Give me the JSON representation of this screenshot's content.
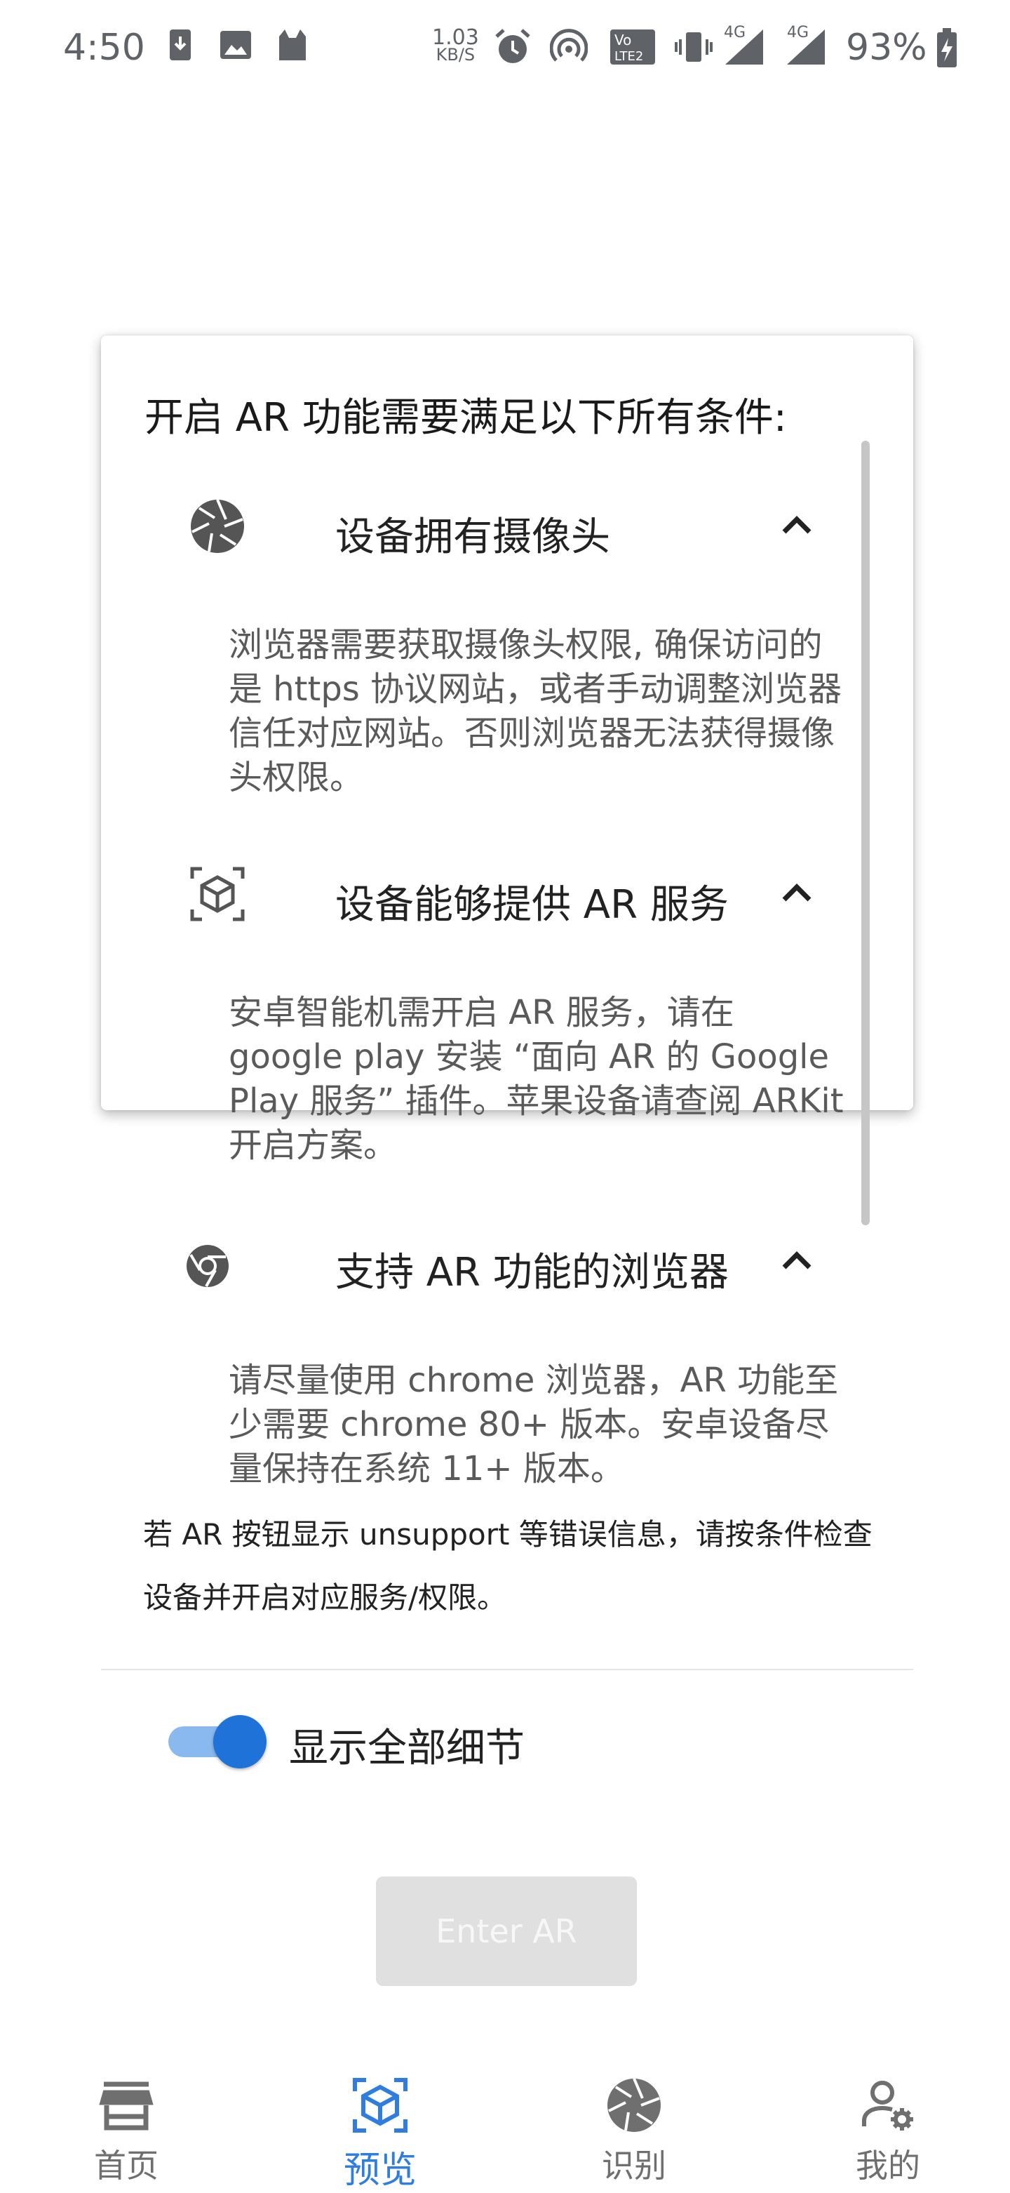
{
  "status_bar": {
    "time": "4:50",
    "speed_value": "1.03",
    "speed_unit": "KB/S",
    "net_label_1": "4G",
    "net_label_2": "4G",
    "battery": "93%",
    "icons": [
      "download-icon",
      "image-icon",
      "cat-app-icon",
      "alarm-icon",
      "hotspot-icon",
      "volte-icon",
      "vibrate-icon",
      "signal-icon",
      "signal-icon",
      "battery-charging-icon"
    ]
  },
  "dialog": {
    "title": "开启 AR 功能需要满足以下所有条件:",
    "requirements": [
      {
        "icon": "camera-aperture-icon",
        "title": "设备拥有摄像头",
        "description": "浏览器需要获取摄像头权限, 确保访问的是 https 协议网站，或者手动调整浏览器信任对应网站。否则浏览器无法获得摄像头权限。"
      },
      {
        "icon": "ar-cube-icon",
        "title": "设备能够提供 AR 服务",
        "description": "安卓智能机需开启 AR 服务，请在 google play 安装 “面向 AR 的 Google Play 服务” 插件。苹果设备请查阅 ARKit 开启方案。"
      },
      {
        "icon": "chrome-icon",
        "title": "支持 AR 功能的浏览器",
        "description": "请尽量使用 chrome 浏览器，AR 功能至少需要 chrome 80+ 版本。安卓设备尽量保持在系统 11+ 版本。"
      }
    ],
    "note": "若 AR 按钮显示 unsupport 等错误信息，请按条件检查设备并开启对应服务/权限。",
    "toggle_label": "显示全部细节",
    "toggle_on": true
  },
  "enter_ar_label": "Enter AR",
  "bottom_nav": {
    "items": [
      {
        "label": "首页",
        "icon": "store-icon"
      },
      {
        "label": "预览",
        "icon": "ar-cube-icon"
      },
      {
        "label": "识别",
        "icon": "camera-aperture-icon"
      },
      {
        "label": "我的",
        "icon": "user-settings-icon"
      }
    ],
    "active_index": 1
  },
  "colors": {
    "accent": "#2f7de1",
    "toggle_track": "#8ab9ef",
    "toggle_thumb": "#1e72d8",
    "disabled_button": "#e0e0e0"
  }
}
